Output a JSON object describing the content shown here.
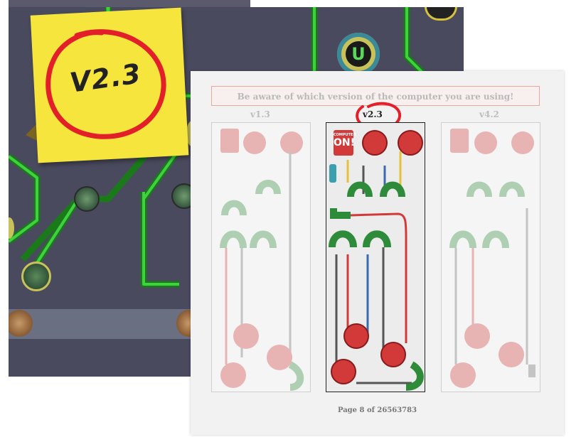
{
  "note": {
    "text": "V2.3"
  },
  "document": {
    "banner": "Be aware of which version of the computer you are using!",
    "versions": [
      "v1.3",
      "v2.3",
      "v4.2"
    ],
    "pager": "Page 8 of 26563783"
  },
  "panel_badge": {
    "line1": "COMPUTER",
    "line2": "ON!"
  },
  "board_badge": {
    "letter": "U"
  },
  "colors": {
    "board": "#4a4a5e",
    "trace": "#3fd13f",
    "note": "#f6e53c",
    "annotation": "#e3202a",
    "cable_green": "#2e8b3a",
    "cable_red": "#d23a3a",
    "cable_gray": "#6a6a6a"
  }
}
